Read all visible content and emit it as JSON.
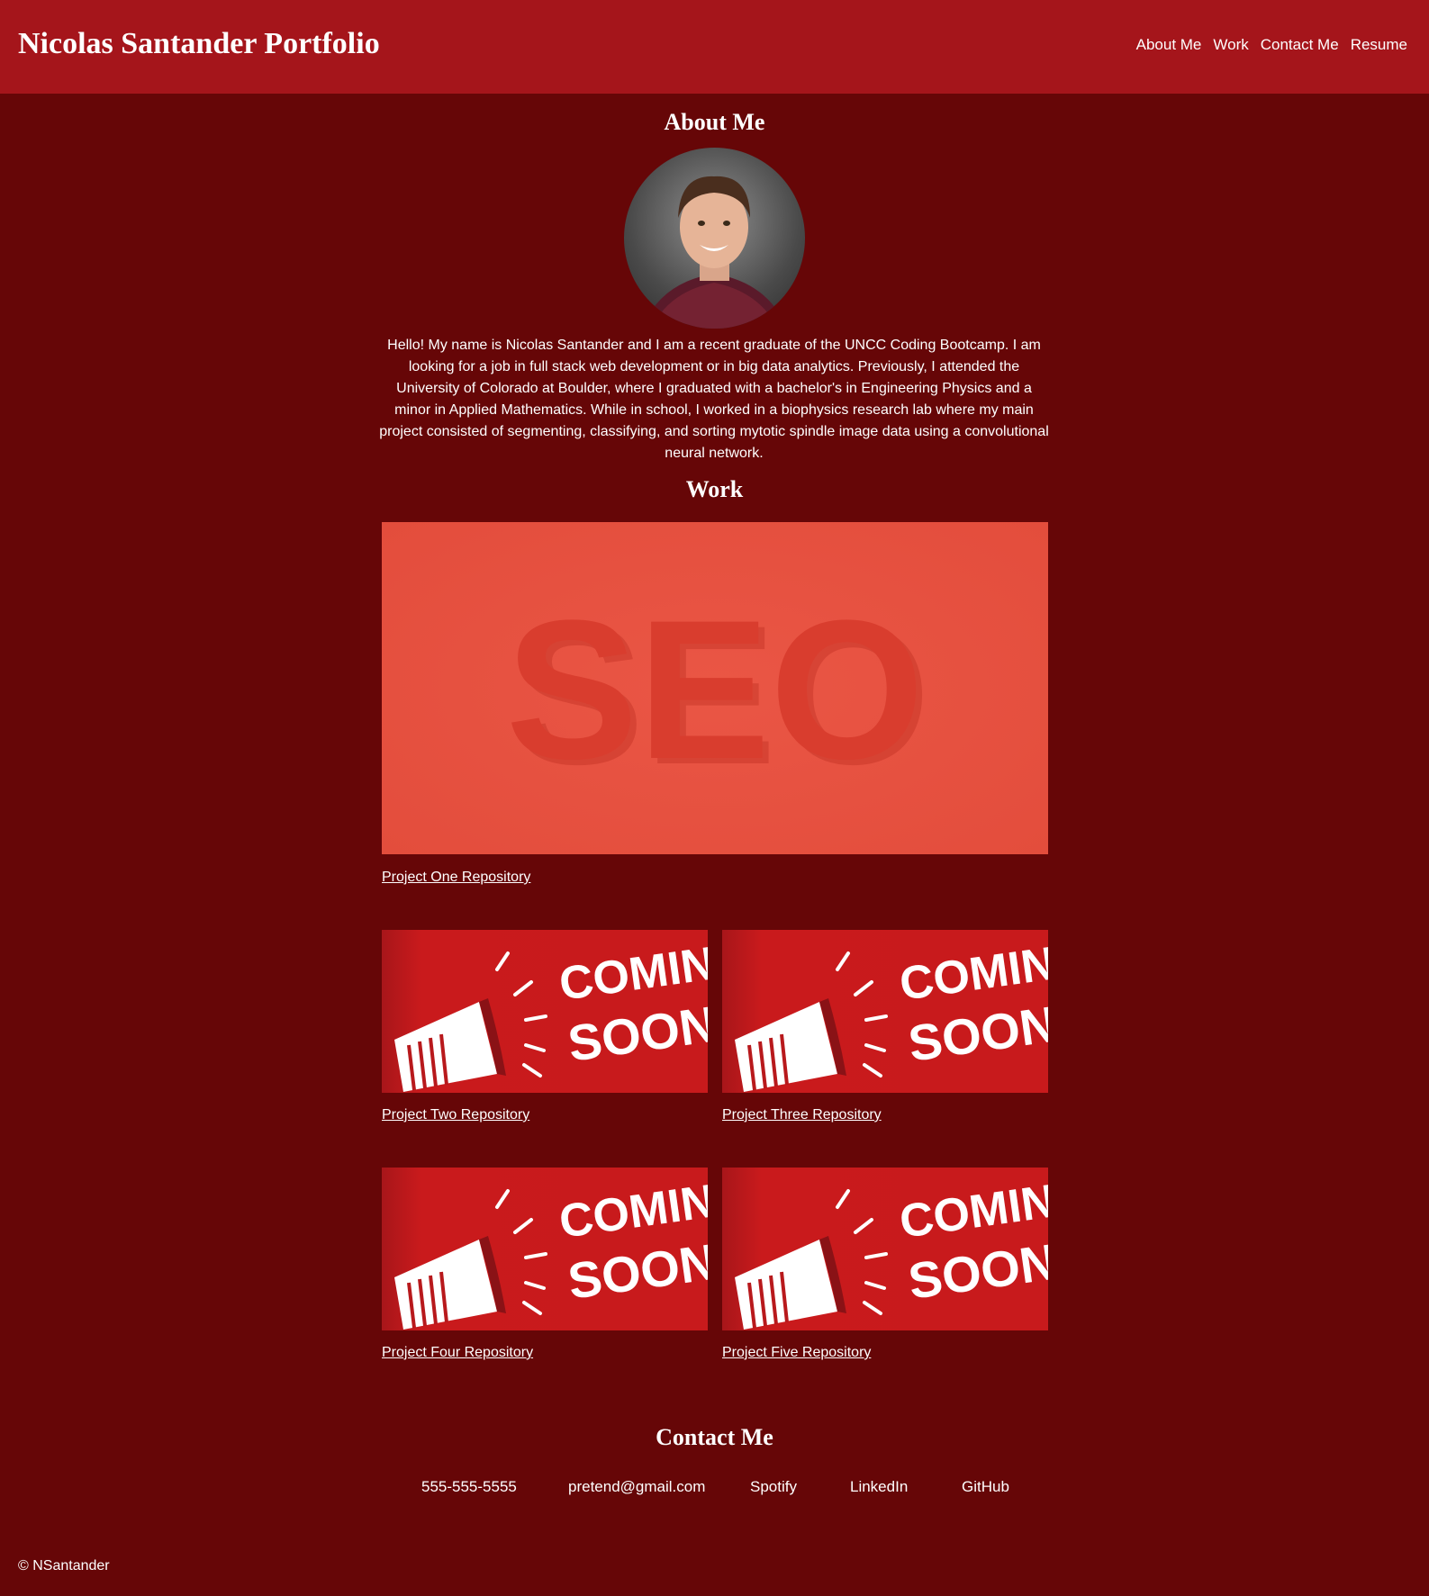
{
  "header": {
    "title": "Nicolas Santander Portfolio",
    "nav": [
      "About Me",
      "Work",
      "Contact Me",
      "Resume"
    ]
  },
  "about": {
    "heading": "About Me",
    "bio": "Hello! My name is Nicolas Santander and I am a recent graduate of the UNCC Coding Bootcamp. I am looking for a job in full stack web development or in big data analytics. Previously, I attended the University of Colorado at Boulder, where I graduated with a bachelor's in Engineering Physics and a minor in Applied Mathematics. While in school, I worked in a biophysics research lab where my main project consisted of segmenting, classifying, and sorting mytotic spindle image data using a convolutional neural network."
  },
  "work": {
    "heading": "Work",
    "featured_image_text": "SEO",
    "coming_soon_text": [
      "COMING",
      "SOON"
    ],
    "projects": [
      "Project One Repository",
      "Project Two Repository",
      "Project Three Repository",
      "Project Four Repository",
      "Project Five Repository"
    ]
  },
  "contact": {
    "heading": "Contact Me",
    "items": [
      "555-555-5555",
      "pretend@gmail.com",
      "Spotify",
      "LinkedIn",
      "GitHub"
    ]
  },
  "footer": {
    "text": "© NSantander"
  },
  "colors": {
    "header": "#a5151b",
    "background": "#660607",
    "seo": "#e64f3e",
    "coming_soon": "#c81a1c"
  }
}
